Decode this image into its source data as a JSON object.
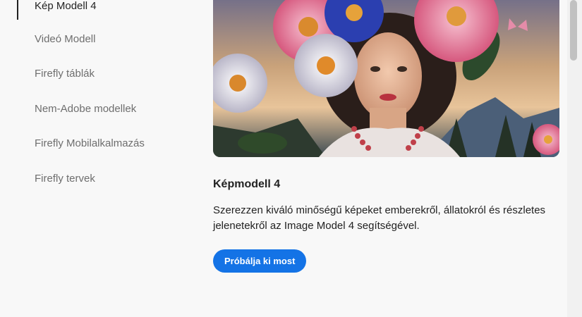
{
  "sidebar": {
    "items": [
      {
        "label": "Kép Modell 4",
        "active": true
      },
      {
        "label": "Videó Modell"
      },
      {
        "label": "Firefly táblák"
      },
      {
        "label": "Nem-Adobe modellek"
      },
      {
        "label": "Firefly Mobilalkalmazás"
      },
      {
        "label": "Firefly tervek"
      }
    ]
  },
  "main": {
    "card": {
      "title": "Képmodell 4",
      "description": "Szerezzen kiváló minőségű képeket emberekről, állatokról és részletes jelenetekről az Image Model 4 segítségével.",
      "cta_label": "Próbálja ki most"
    }
  },
  "colors": {
    "accent": "#1473e6",
    "background": "#f8f8f8",
    "text": "#222222",
    "muted_text": "#6e6e6e"
  },
  "scroll": {
    "position_fraction": 0.0
  }
}
